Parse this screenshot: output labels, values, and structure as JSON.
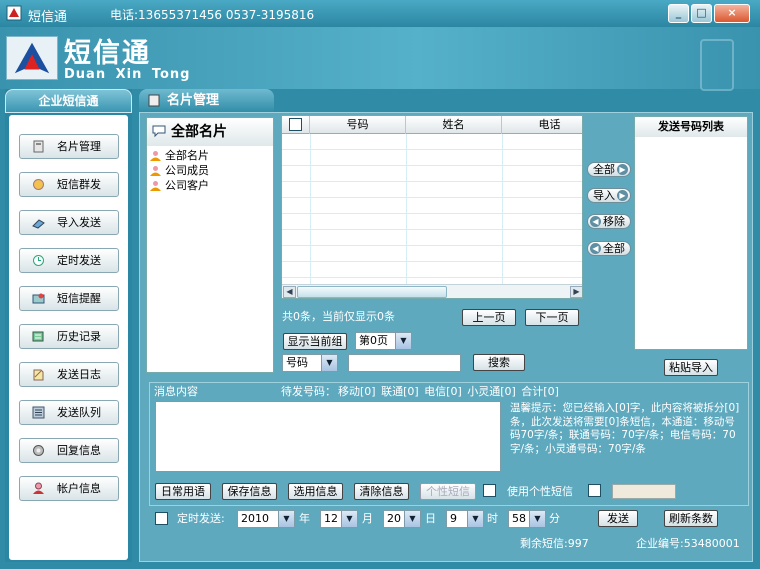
{
  "window": {
    "title": "短信通",
    "phone_text": "电话:13655371456  0537-3195816",
    "minimize": "_",
    "maximize": "□",
    "close": "×"
  },
  "brand": {
    "name": "短信通",
    "subtitle": "Duan Xin Tong"
  },
  "sidebar": {
    "title": "企业短信通",
    "items": [
      {
        "label": "名片管理",
        "icon": "card-icon"
      },
      {
        "label": "短信群发",
        "icon": "broadcast-icon"
      },
      {
        "label": "导入发送",
        "icon": "import-icon"
      },
      {
        "label": "定时发送",
        "icon": "clock-icon"
      },
      {
        "label": "短信提醒",
        "icon": "reminder-icon"
      },
      {
        "label": "历史记录",
        "icon": "history-icon"
      },
      {
        "label": "发送日志",
        "icon": "log-icon"
      },
      {
        "label": "发送队列",
        "icon": "queue-icon"
      },
      {
        "label": "回复信息",
        "icon": "reply-icon"
      },
      {
        "label": "帐户信息",
        "icon": "account-icon"
      }
    ]
  },
  "main_tab": {
    "label": "名片管理"
  },
  "tree": {
    "header": "全部名片",
    "items": [
      "全部名片",
      "公司成员",
      "公司客户"
    ]
  },
  "grid": {
    "columns": [
      "号码",
      "姓名",
      "电话"
    ]
  },
  "pager": {
    "info": "共0条，当前仅显示0条",
    "prev": "上一页",
    "next": "下一页",
    "show_group": "显示当前组",
    "page_select": "第0页",
    "search_field": "号码",
    "search_button": "搜索"
  },
  "transfer": {
    "all_right": "全部",
    "import": "导入",
    "remove": "移除",
    "all_left": "全部",
    "list_title": "发送号码列表",
    "paste_import": "粘贴导入"
  },
  "message": {
    "content_label": "消息内容",
    "pending_label": "待发号码：",
    "counts": "移动[0]  联通[0]  电信[0] 小灵通[0]   合计[0]",
    "hint": "温馨提示：您已经输入[0]字，此内容将被拆分[0]条，此次发送将需要[0]条短信，本通道：移动号码70字/条；联通号码：70字/条；电信号码：70字/条；小灵通号码：70字/条",
    "btn_common": "日常用语",
    "btn_save": "保存信息",
    "btn_select": "选用信息",
    "btn_clear": "清除信息",
    "btn_personal": "个性短信",
    "use_personal": "使用个性短信"
  },
  "schedule": {
    "label": "定时发送:",
    "year": "2010",
    "year_unit": "年",
    "month": "12",
    "month_unit": "月",
    "day": "20",
    "day_unit": "日",
    "hour": "9",
    "hour_unit": "时",
    "minute": "58",
    "minute_unit": "分",
    "send": "发送",
    "refresh": "刷新条数"
  },
  "status": {
    "remaining": "剩余短信:997",
    "enterprise_id": "企业编号:53480001"
  }
}
